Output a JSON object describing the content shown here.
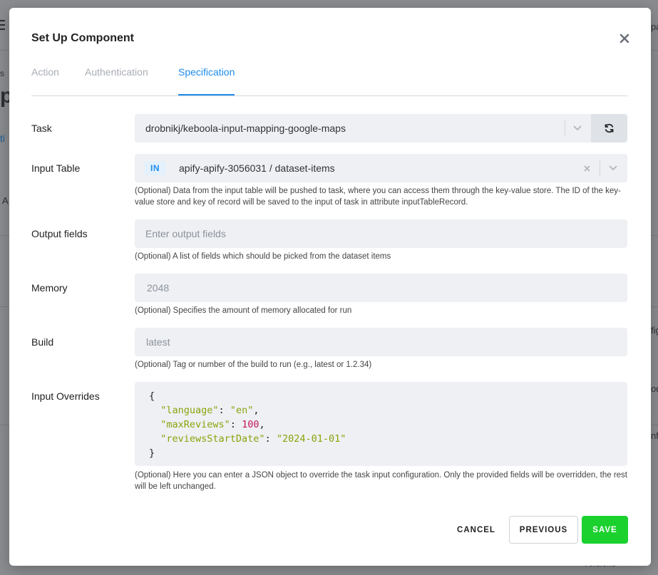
{
  "modal": {
    "title": "Set Up Component",
    "tabs": [
      {
        "label": "Action"
      },
      {
        "label": "Authentication"
      },
      {
        "label": "Specification"
      }
    ]
  },
  "task": {
    "label": "Task",
    "value": "drobnikj/keboola-input-mapping-google-maps"
  },
  "input_table": {
    "label": "Input Table",
    "badge": "IN",
    "value": "apify-apify-3056031 / dataset-items",
    "help": "(Optional) Data from the input table will be pushed to task, where you can access them through the key-value store. The ID of the key-value store and key of record will be saved to the input of task in attribute inputTableRecord."
  },
  "output_fields": {
    "label": "Output fields",
    "placeholder": "Enter output fields",
    "help": "(Optional) A list of fields which should be picked from the dataset items"
  },
  "memory": {
    "label": "Memory",
    "value": "2048",
    "help": "(Optional) Specifies the amount of memory allocated for run"
  },
  "build": {
    "label": "Build",
    "value": "latest",
    "help": "(Optional) Tag or number of the build to run (e.g., latest or 1.2.34)"
  },
  "input_overrides": {
    "label": "Input Overrides",
    "code": {
      "open": "{",
      "line1_key": "\"language\"",
      "line1_val": "\"en\"",
      "line2_key": "\"maxReviews\"",
      "line2_val": "100",
      "line3_key": "\"reviewsStartDate\"",
      "line3_val": "\"2024-01-01\"",
      "close": "}"
    },
    "help": "(Optional) Here you can enter a JSON object to override the task input configuration. Only the provided fields will be overridden, the rest will be left unchanged."
  },
  "buttons": {
    "cancel": "CANCEL",
    "previous": "PREVIOUS",
    "save": "SAVE"
  },
  "background": {
    "frag_right_1": "pa",
    "frag_right_2": "fig",
    "frag_right_3": "od",
    "frag_right_4": "nf",
    "frag_bottom": "Versions",
    "frag_left_1": "s",
    "frag_left_2": "pi",
    "frag_left_3": "ti",
    "frag_left_4": "A"
  },
  "colors": {
    "accent": "#1f8ceb",
    "save": "#1bd12e",
    "field_bg": "#eef0f4"
  }
}
